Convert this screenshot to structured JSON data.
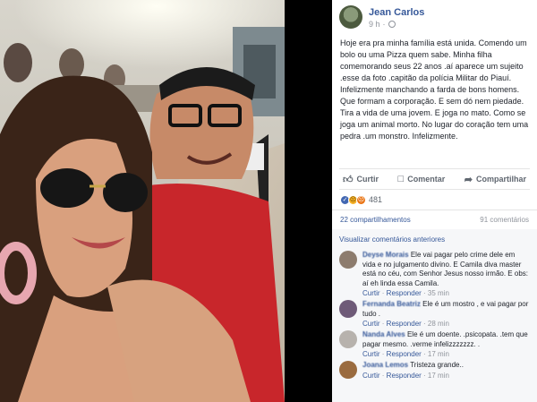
{
  "post": {
    "author": "Jean Carlos",
    "time": "9 h",
    "text": "Hoje era pra minha família está unida. Comendo um bolo ou uma Pizza quem sabe. Minha filha comemorando seus 22 anos .aí aparece um sujeito .esse da foto .capitão da polícia Militar do Piauí. Infelizmente manchando a farda de bons homens. Que formam a corporação. E sem dó nem piedade. Tira a vida de uma jovem. E joga no mato. Como se joga um animal morto. No lugar do coração tem uma pedra .um monstro. Infelizmente."
  },
  "actions": {
    "like": "Curtir",
    "comment": "Comentar",
    "share": "Compartilhar"
  },
  "reactions": {
    "count": "481"
  },
  "stats": {
    "shares": "22 compartilhamentos",
    "comments": "91 comentários"
  },
  "comments": {
    "previous": "Visualizar comentários anteriores",
    "items": [
      {
        "name": "Deyse Morais",
        "text": "Ele vai pagar pelo crime dele em vida e no julgamento divino. E Camila diva master está no céu, com Senhor Jesus nosso irmão. E obs: aí eh linda essa Camila.",
        "like": "Curtir",
        "reply": "Responder",
        "time": "35 min",
        "avatar_color": "#8d7c6e"
      },
      {
        "name": "Fernanda Beatriz",
        "text": "Ele é um mostro , e vai pagar por tudo .",
        "like": "Curtir",
        "reply": "Responder",
        "time": "28 min",
        "avatar_color": "#6e5a78"
      },
      {
        "name": "Nanda Alves",
        "text": "Ele é um doente. .psicopata. .tem que pagar mesmo. .verme infelizzzzzzz. .",
        "like": "Curtir",
        "reply": "Responder",
        "time": "17 min",
        "avatar_color": "#b7b2ad"
      },
      {
        "name": "Joana Lemos",
        "text": "Tristeza grande..",
        "like": "Curtir",
        "reply": "Responder",
        "time": "17 min",
        "avatar_color": "#9a6b3f"
      }
    ]
  },
  "colors": {
    "link": "#365899",
    "muted": "#90949c",
    "like_reaction": "#4267b2"
  }
}
